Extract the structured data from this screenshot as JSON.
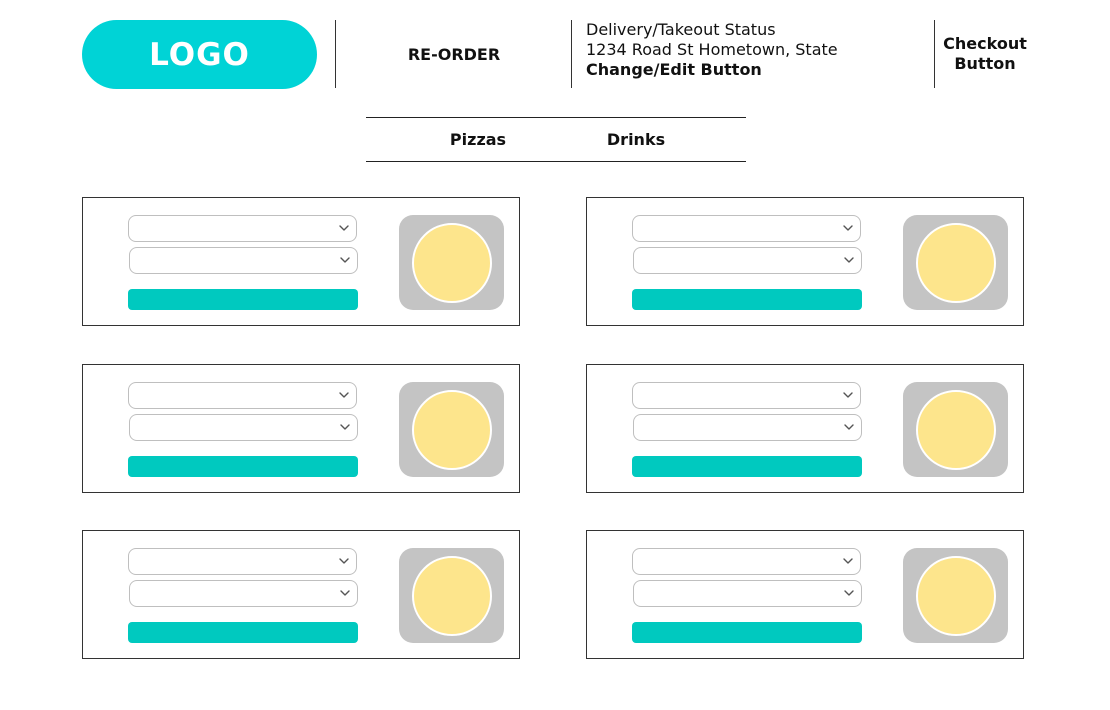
{
  "header": {
    "logo_text": "LOGO",
    "reorder_label": "RE-ORDER",
    "status_line": "Delivery/Takeout Status",
    "address_line": "1234 Road St Hometown, State",
    "edit_label": "Change/Edit Button",
    "checkout_line1": "Checkout",
    "checkout_line2": "Button"
  },
  "tabs": [
    {
      "label": "Pizzas"
    },
    {
      "label": "Drinks"
    }
  ],
  "menu_cards": [
    {
      "icons": [
        "chevron-down-icon",
        "chevron-down-icon"
      ],
      "image": "pizza-icon"
    },
    {
      "icons": [
        "chevron-down-icon",
        "chevron-down-icon"
      ],
      "image": "pizza-icon"
    },
    {
      "icons": [
        "chevron-down-icon",
        "chevron-down-icon"
      ],
      "image": "pizza-icon"
    },
    {
      "icons": [
        "chevron-down-icon",
        "chevron-down-icon"
      ],
      "image": "pizza-icon"
    },
    {
      "icons": [
        "chevron-down-icon",
        "chevron-down-icon"
      ],
      "image": "pizza-icon"
    },
    {
      "icons": [
        "chevron-down-icon",
        "chevron-down-icon"
      ],
      "image": "pizza-icon"
    }
  ],
  "colors": {
    "brand_accent": "#00d3d6",
    "add_button": "#00c9bf",
    "image_placeholder": "#c4c4c4",
    "pizza": "#fde58c",
    "border": "#333333"
  }
}
